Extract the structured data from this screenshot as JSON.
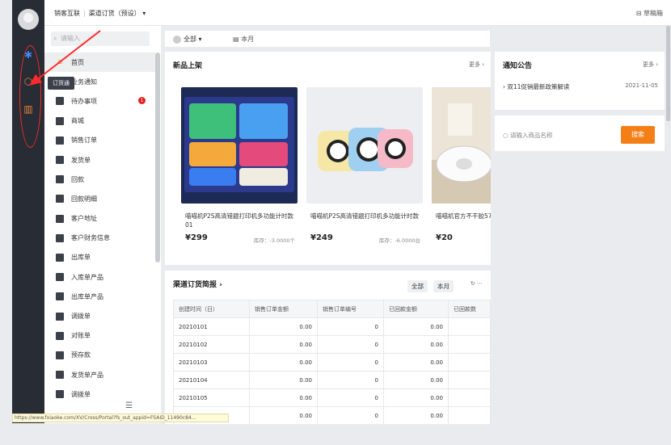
{
  "topbar": {
    "company": "销客互联",
    "channel": "渠道订货（预设）",
    "mode": "草稿箱"
  },
  "tooltip": "订货通",
  "sidebar": {
    "search_placeholder": "请输入",
    "items": [
      {
        "label": "首页",
        "active": true
      },
      {
        "label": "业务通知"
      },
      {
        "label": "待办事项",
        "badge": "1"
      },
      {
        "label": "商城"
      },
      {
        "label": "销售订单"
      },
      {
        "label": "发货单"
      },
      {
        "label": "回款"
      },
      {
        "label": "回款明细"
      },
      {
        "label": "客户地址"
      },
      {
        "label": "客户财务信息"
      },
      {
        "label": "出库单"
      },
      {
        "label": "入库单产品"
      },
      {
        "label": "出库单产品"
      },
      {
        "label": "调拨单"
      },
      {
        "label": "对账单"
      },
      {
        "label": "预存款"
      },
      {
        "label": "发货单产品"
      },
      {
        "label": "调拨单"
      }
    ]
  },
  "filter": {
    "scope": "全部 ▾",
    "period": "本月"
  },
  "products": {
    "title": "新品上架",
    "more": "更多 ›",
    "items": [
      {
        "name": "喵喵机P2S高清错题打印机多功能计时款01",
        "price": "¥299",
        "stock": "库存：-3.0000个"
      },
      {
        "name": "喵喵机P2S高清错题打印机多功能计时款",
        "price": "¥249",
        "stock": "库存：-6.0000台"
      },
      {
        "name": "喵喵机官方不干胶57*30mm(一盒",
        "price": "¥20",
        "stock": ""
      }
    ]
  },
  "notice": {
    "title": "通知公告",
    "more": "更多 ›",
    "item": "双11促销最新政策解读",
    "date": "2021-11-05"
  },
  "goods_search": {
    "placeholder": "请输入商品名称",
    "button": "搜索"
  },
  "report": {
    "title": "渠道订货简报 ›",
    "seg_all": "全部",
    "seg_month": "本月",
    "columns": [
      "创建时间（日）",
      "销售订单金额",
      "销售订单编号",
      "已回款金额",
      "已回款数"
    ],
    "rows": [
      [
        "20210101",
        "0.00",
        "0",
        "0.00",
        ""
      ],
      [
        "20210102",
        "0.00",
        "0",
        "0.00",
        ""
      ],
      [
        "20210103",
        "0.00",
        "0",
        "0.00",
        ""
      ],
      [
        "20210104",
        "0.00",
        "0",
        "0.00",
        ""
      ],
      [
        "20210105",
        "0.00",
        "0",
        "0.00",
        ""
      ],
      [
        "",
        "0.00",
        "0",
        "0.00",
        ""
      ]
    ]
  },
  "statusbar": "https://www.fxiaoke.com/XV/Cross/Portal?fs_out_appid=FSAID_11490c84...",
  "colors": {
    "accent": "#f57f17",
    "rail": "#272c35",
    "annotation": "#ff2a2a"
  }
}
